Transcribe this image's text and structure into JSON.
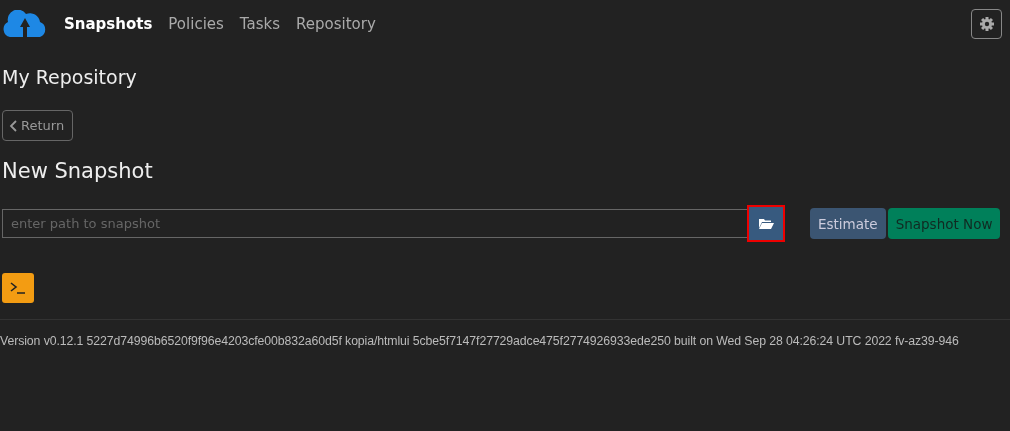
{
  "nav": {
    "items": [
      {
        "label": "Snapshots",
        "selected": true
      },
      {
        "label": "Policies",
        "selected": false
      },
      {
        "label": "Tasks",
        "selected": false
      },
      {
        "label": "Repository",
        "selected": false
      }
    ]
  },
  "page_title": "My Repository",
  "return_button": {
    "label": "Return"
  },
  "section_title": "New Snapshot",
  "path_field": {
    "placeholder": "enter path to snapshot"
  },
  "browse_button": {
    "highlighted": true
  },
  "buttons": [
    {
      "label": "Estimate",
      "kind": "secondary"
    },
    {
      "label": "Snapshot Now",
      "kind": "success"
    }
  ],
  "footer": "Version v0.12.1 5227d74996b6520f9f96e4203cfe00b832a60d5f kopia/htmlui 5cbe5f7147f27729adce475f2774926933ede250 built on Wed Sep 28 04:26:24 UTC 2022 fv-az39-946"
}
